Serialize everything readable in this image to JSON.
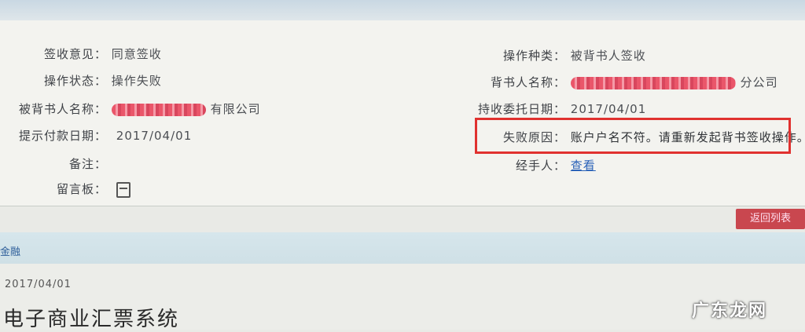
{
  "left": {
    "sign_opinion": {
      "label": "签收意见：",
      "value": "同意签收"
    },
    "operation_status": {
      "label": "操作状态：",
      "value": "操作失败"
    },
    "endorsee_name": {
      "label": "被背书人名称：",
      "value": "有限公司"
    },
    "request_date": {
      "label": "提示付款日期：",
      "value": "2017/04/01"
    },
    "remark": {
      "label": "备注："
    },
    "message_board": {
      "label": "留言板："
    }
  },
  "right": {
    "operation_type": {
      "label": "操作种类：",
      "value": "被背书人签收"
    },
    "endorser_name": {
      "label": "背书人名称：",
      "value": "分公司"
    },
    "entrust_date": {
      "label": "持收委托日期：",
      "value": "2017/04/01"
    },
    "failure_reason": {
      "label": "失败原因：",
      "value": "账户户名不符。请重新发起背书签收操作。"
    },
    "handler": {
      "label": "经手人：",
      "value": "查看"
    }
  },
  "back_button": {
    "label": "返回列表"
  },
  "band_label": "金融",
  "lower_date": "2017/04/01",
  "seal_text": "电子商业汇票系统",
  "watermark": "广东龙网",
  "colors": {
    "highlight_box": "#e0312f",
    "button": "#c9474f",
    "link": "#2a62b8"
  }
}
